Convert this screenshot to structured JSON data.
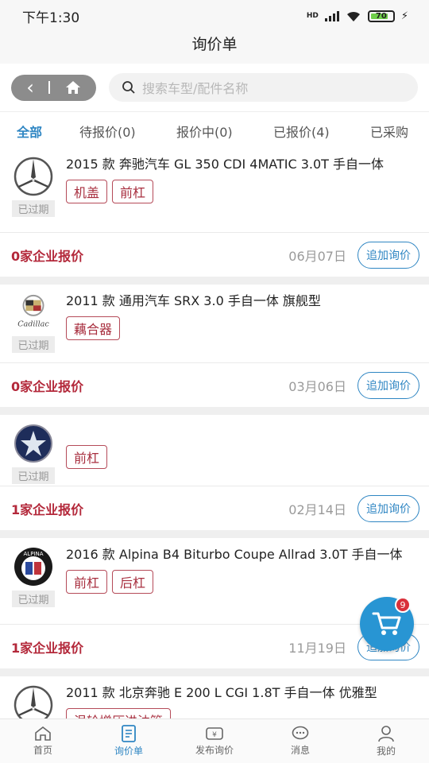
{
  "status_bar": {
    "time": "下午1:30",
    "battery": "70"
  },
  "header": {
    "title": "询价单"
  },
  "search": {
    "placeholder": "搜索车型/配件名称"
  },
  "tabs": [
    "全部",
    "待报价(0)",
    "报价中(0)",
    "已报价(4)",
    "已采购"
  ],
  "inquiries": [
    {
      "title": "2015 款 奔驰汽车 GL 350 CDI 4MATIC 3.0T 手自一体",
      "status": "已过期",
      "tags": [
        "机盖",
        "前杠"
      ],
      "quote": "0家企业报价",
      "date": "06月07日",
      "button": "追加询价",
      "logo": "mercedes-logo"
    },
    {
      "title": "2011 款 通用汽车 SRX 3.0 手自一体 旗舰型",
      "status": "已过期",
      "tags": [
        "藕合器"
      ],
      "quote": "0家企业报价",
      "date": "03月06日",
      "button": "追加询价",
      "logo": "cadillac-logo"
    },
    {
      "title": "",
      "status": "已过期",
      "tags": [
        "前杠"
      ],
      "quote": "1家企业报价",
      "date": "02月14日",
      "button": "追加询价",
      "logo": "star-logo"
    },
    {
      "title": "2016 款 Alpina B4 Biturbo Coupe Allrad 3.0T 手自一体",
      "status": "已过期",
      "tags": [
        "前杠",
        "后杠"
      ],
      "quote": "1家企业报价",
      "date": "11月19日",
      "button": "追加询价",
      "logo": "alpina-logo"
    },
    {
      "title": "2011 款 北京奔驰 E 200 L CGI 1.8T 手自一体 优雅型",
      "status": "",
      "tags": [
        "涡轮增压进油管"
      ],
      "quote": "",
      "date": "",
      "button": "",
      "logo": "mercedes-logo"
    }
  ],
  "cart": {
    "badge": "9"
  },
  "bottom_nav": [
    "首页",
    "询价单",
    "发布询价",
    "消息",
    "我的"
  ],
  "colors": {
    "accent": "#2f86c3",
    "quote_red": "#b3283a",
    "tag_red": "#a82f3f"
  }
}
